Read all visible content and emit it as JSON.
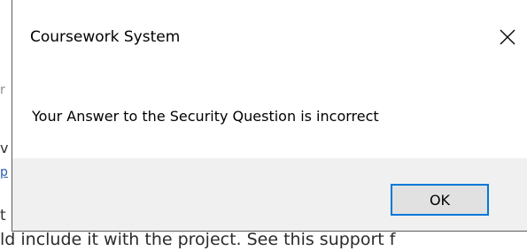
{
  "dialog": {
    "title": "Coursework System",
    "message": "Your Answer to the Security Question is incorrect",
    "ok_label": "OK",
    "close_icon": "close-icon"
  },
  "background": {
    "fragments": [
      "r",
      "v",
      "p",
      "t"
    ],
    "bottom_line": "ld include it with the project. See this support f"
  },
  "colors": {
    "accent": "#0078d7",
    "footer_bg": "#f0f0f0",
    "button_bg": "#e1e1e1"
  }
}
